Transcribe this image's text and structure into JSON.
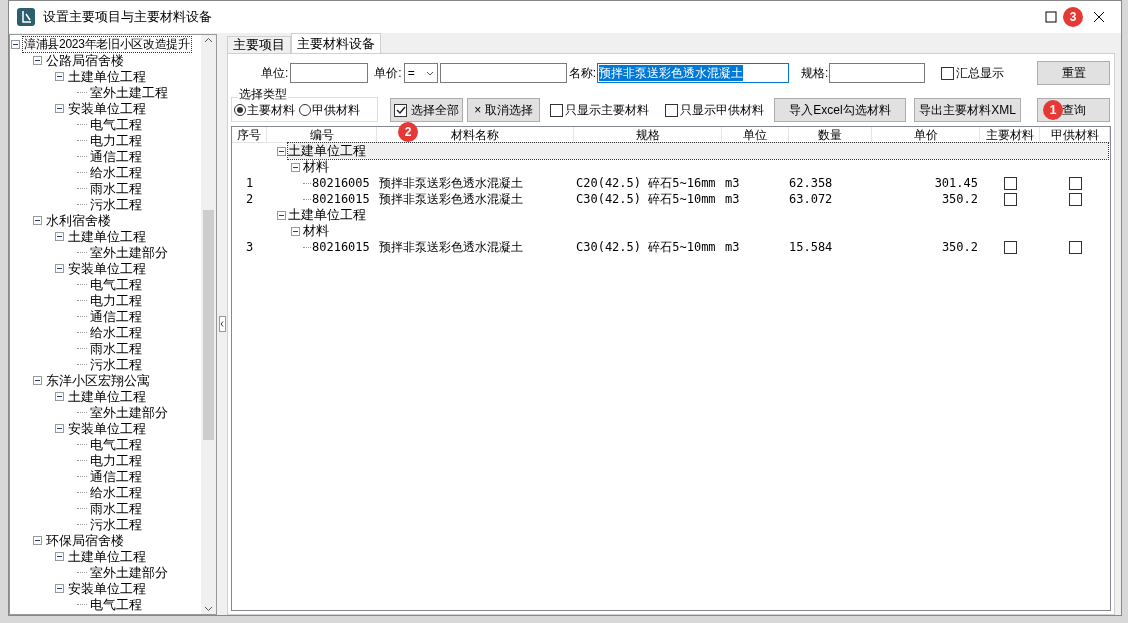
{
  "window": {
    "title": "设置主要项目与主要材料设备"
  },
  "tree": [
    {
      "label": "漳浦县2023年老旧小区改造提升",
      "expanded": true,
      "selected": true,
      "children": [
        {
          "label": "公路局宿舍楼",
          "expanded": true,
          "children": [
            {
              "label": "土建单位工程",
              "expanded": true,
              "children": [
                {
                  "label": "室外土建工程"
                }
              ]
            },
            {
              "label": "安装单位工程",
              "expanded": true,
              "children": [
                {
                  "label": "电气工程"
                },
                {
                  "label": "电力工程"
                },
                {
                  "label": "通信工程"
                },
                {
                  "label": "给水工程"
                },
                {
                  "label": "雨水工程"
                },
                {
                  "label": "污水工程"
                }
              ]
            }
          ]
        },
        {
          "label": "水利宿舍楼",
          "expanded": true,
          "children": [
            {
              "label": "土建单位工程",
              "expanded": true,
              "children": [
                {
                  "label": "室外土建部分"
                }
              ]
            },
            {
              "label": "安装单位工程",
              "expanded": true,
              "children": [
                {
                  "label": "电气工程"
                },
                {
                  "label": "电力工程"
                },
                {
                  "label": "通信工程"
                },
                {
                  "label": "给水工程"
                },
                {
                  "label": "雨水工程"
                },
                {
                  "label": "污水工程"
                }
              ]
            }
          ]
        },
        {
          "label": "东洋小区宏翔公寓",
          "expanded": true,
          "children": [
            {
              "label": "土建单位工程",
              "expanded": true,
              "children": [
                {
                  "label": "室外土建部分"
                }
              ]
            },
            {
              "label": "安装单位工程",
              "expanded": true,
              "children": [
                {
                  "label": "电气工程"
                },
                {
                  "label": "电力工程"
                },
                {
                  "label": "通信工程"
                },
                {
                  "label": "给水工程"
                },
                {
                  "label": "雨水工程"
                },
                {
                  "label": "污水工程"
                }
              ]
            }
          ]
        },
        {
          "label": "环保局宿舍楼",
          "expanded": true,
          "children": [
            {
              "label": "土建单位工程",
              "expanded": true,
              "children": [
                {
                  "label": "室外土建部分"
                }
              ]
            },
            {
              "label": "安装单位工程",
              "expanded": true,
              "children": [
                {
                  "label": "电气工程"
                }
              ]
            }
          ]
        }
      ]
    }
  ],
  "tabs": [
    {
      "label": "主要项目",
      "selected": false
    },
    {
      "label": "主要材料设备",
      "selected": true
    }
  ],
  "form": {
    "unit_label": "单位:",
    "price_label": "单价:",
    "price_operator": "=",
    "name_label": "名称:",
    "name_value": "预拌非泵送彩色透水混凝土",
    "spec_label": "规格:",
    "summary": {
      "label": "汇总显示",
      "checked": false
    },
    "type_group": {
      "title": "选择类型",
      "options": [
        {
          "label": "主要材料",
          "selected": true
        },
        {
          "label": "甲供材料",
          "selected": false
        }
      ]
    },
    "select_all": {
      "label": "选择全部",
      "checked": true
    },
    "deselect": {
      "icon": "×",
      "label": "取消选择"
    },
    "only_main": {
      "label": "只显示主要材料",
      "checked": false
    },
    "only_supplied": {
      "label": "只显示甲供材料",
      "checked": false
    },
    "buttons": [
      "导入Excel勾选材料",
      "导出主要材料XML"
    ],
    "reset": "重置",
    "query": "查询"
  },
  "table": {
    "columns": [
      "序号",
      "编号",
      "材料名称",
      "规格",
      "单位",
      "数量",
      "单价",
      "主要材料",
      "甲供材料"
    ],
    "rows": [
      {
        "kind": "group",
        "label": "土建单位工程",
        "selected": true
      },
      {
        "kind": "subgroup",
        "label": "材料"
      },
      {
        "kind": "item",
        "index": "1",
        "code": "80216005",
        "name": "预拌非泵送彩色透水混凝土",
        "spec": "C20(42.5) 碎石5~16mm",
        "unit": "m3",
        "quantity": "62.358",
        "price": "301.45",
        "main": false,
        "supplied": false
      },
      {
        "kind": "item",
        "index": "2",
        "code": "80216015",
        "name": "预拌非泵送彩色透水混凝土",
        "spec": "C30(42.5) 碎石5~10mm",
        "unit": "m3",
        "quantity": "63.072",
        "price": "350.2",
        "main": false,
        "supplied": false
      },
      {
        "kind": "group",
        "label": "土建单位工程",
        "selected": false
      },
      {
        "kind": "subgroup",
        "label": "材料"
      },
      {
        "kind": "item",
        "index": "3",
        "code": "80216015",
        "name": "预拌非泵送彩色透水混凝土",
        "spec": "C30(42.5) 碎石5~10mm",
        "unit": "m3",
        "quantity": "15.584",
        "price": "350.2",
        "main": false,
        "supplied": false
      }
    ]
  },
  "markers": [
    "1",
    "2",
    "3"
  ]
}
